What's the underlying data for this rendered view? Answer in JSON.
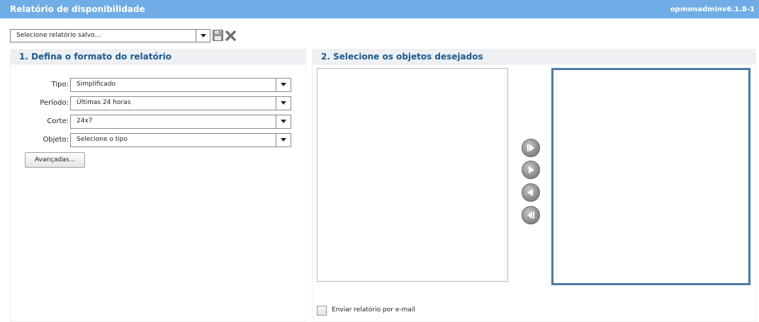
{
  "window": {
    "title": "Relatório de disponibilidade",
    "user": "opmonadmin",
    "version": "v6.1.8-1"
  },
  "saved_report": {
    "placeholder": "Selecione relatório salvo..."
  },
  "left_panel": {
    "heading": "1. Defina o formato do relatório",
    "fields": [
      {
        "label": "Tipo:",
        "value": "Simplificado"
      },
      {
        "label": "Período:",
        "value": "Últimas 24 horas"
      },
      {
        "label": "Corte:",
        "value": "24x7"
      },
      {
        "label": "Objeto:",
        "value": "Selecione o tipo"
      }
    ],
    "advanced_button": "Avançadas..."
  },
  "right_panel": {
    "heading": "2. Selecione os objetos desejados",
    "email_label": "Enviar relatório por e-mail"
  },
  "icons": {
    "save": "floppy-disk-icon",
    "delete": "x-icon",
    "add_all": "play-with-bar-icon",
    "add": "play-icon",
    "remove": "reverse-play-icon",
    "remove_all": "reverse-play-with-bar-icon"
  },
  "colors": {
    "titlebar": "#70ade6",
    "heading_text": "#1d5a90",
    "destination_border": "#4a7aa5"
  }
}
